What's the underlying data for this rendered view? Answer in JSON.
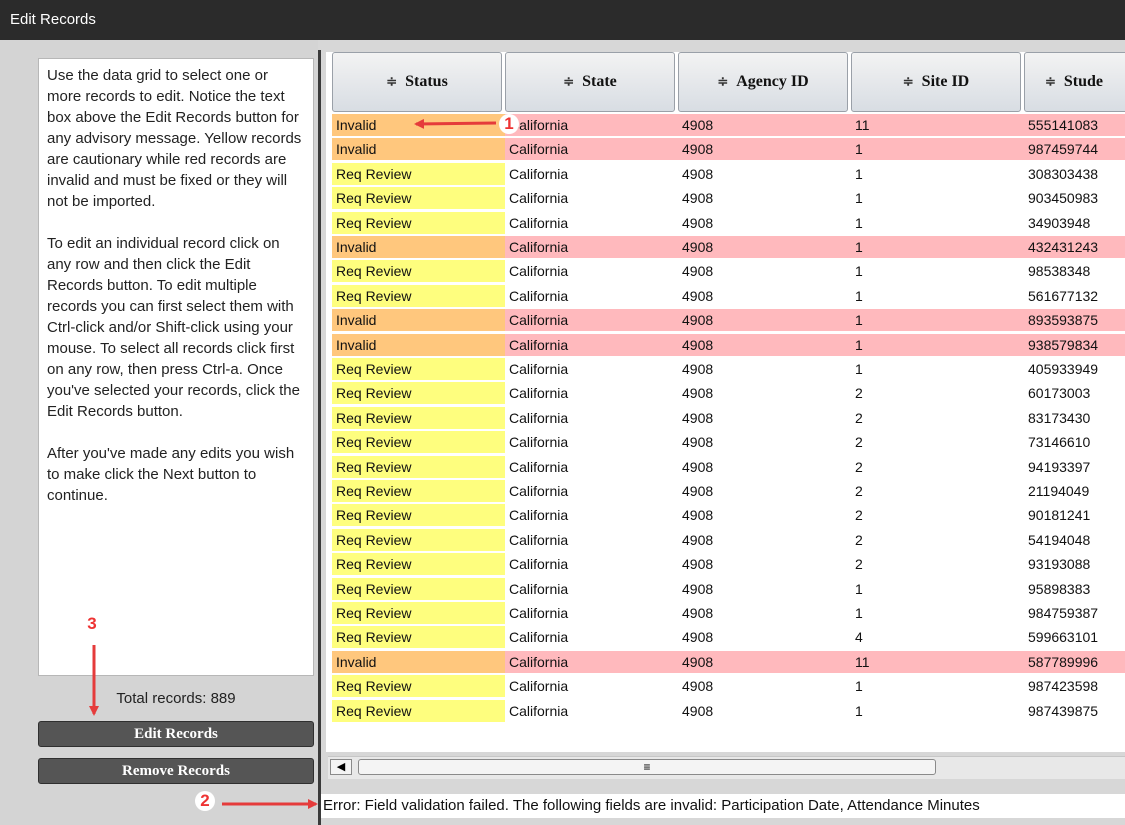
{
  "window": {
    "title": "Edit Records"
  },
  "help": {
    "paragraphs": [
      "Use the data grid to select one or more records to edit. Notice the text box above the Edit Records button for any advisory message. Yellow records are cautionary while red records are invalid and must be fixed or they will not be imported.",
      "To edit an individual record click on any row and then click the Edit Records button. To edit multiple records you can first select them with Ctrl-click and/or Shift-click using your mouse. To select all records click first on any row, then press Ctrl-a. Once you've selected your records, click the Edit Records button.",
      "After you've made any edits you wish to make click the Next button to continue."
    ]
  },
  "total_records": "Total records: 889",
  "buttons": {
    "edit": "Edit Records",
    "remove": "Remove Records"
  },
  "grid": {
    "sort_glyph": "≑",
    "columns": [
      "Status",
      "State",
      "Agency ID",
      "Site ID",
      "Stude"
    ],
    "rows": [
      [
        "Invalid",
        "California",
        "4908",
        "11",
        "555141083"
      ],
      [
        "Invalid",
        "California",
        "4908",
        "1",
        "987459744"
      ],
      [
        "Req Review",
        "California",
        "4908",
        "1",
        "308303438"
      ],
      [
        "Req Review",
        "California",
        "4908",
        "1",
        "903450983"
      ],
      [
        "Req Review",
        "California",
        "4908",
        "1",
        "34903948"
      ],
      [
        "Invalid",
        "California",
        "4908",
        "1",
        "432431243"
      ],
      [
        "Req Review",
        "California",
        "4908",
        "1",
        "98538348"
      ],
      [
        "Req Review",
        "California",
        "4908",
        "1",
        "561677132"
      ],
      [
        "Invalid",
        "California",
        "4908",
        "1",
        "893593875"
      ],
      [
        "Invalid",
        "California",
        "4908",
        "1",
        "938579834"
      ],
      [
        "Req Review",
        "California",
        "4908",
        "1",
        "405933949"
      ],
      [
        "Req Review",
        "California",
        "4908",
        "2",
        "60173003"
      ],
      [
        "Req Review",
        "California",
        "4908",
        "2",
        "83173430"
      ],
      [
        "Req Review",
        "California",
        "4908",
        "2",
        "73146610"
      ],
      [
        "Req Review",
        "California",
        "4908",
        "2",
        "94193397"
      ],
      [
        "Req Review",
        "California",
        "4908",
        "2",
        "21194049"
      ],
      [
        "Req Review",
        "California",
        "4908",
        "2",
        "90181241"
      ],
      [
        "Req Review",
        "California",
        "4908",
        "2",
        "54194048"
      ],
      [
        "Req Review",
        "California",
        "4908",
        "2",
        "93193088"
      ],
      [
        "Req Review",
        "California",
        "4908",
        "1",
        "95898383"
      ],
      [
        "Req Review",
        "California",
        "4908",
        "1",
        "984759387"
      ],
      [
        "Req Review",
        "California",
        "4908",
        "4",
        "599663101"
      ],
      [
        "Invalid",
        "California",
        "4908",
        "11",
        "587789996"
      ],
      [
        "Req Review",
        "California",
        "4908",
        "1",
        "987423598"
      ],
      [
        "Req Review",
        "California",
        "4908",
        "1",
        "987439875"
      ]
    ]
  },
  "scrollbar": {
    "left_arrow": "◀",
    "thumb_grip": "≡"
  },
  "status_message": "Error: Field validation failed. The following fields are invalid: Participation Date,  Attendance Minutes",
  "annotations": {
    "marker1": "1",
    "marker2": "2",
    "marker3": "3"
  },
  "colors": {
    "invalid_status_bg": "#ffc77d",
    "invalid_row_bg": "#ffb9bd",
    "review_status_bg": "#fefe7e",
    "review_row_bg": "#ffffff",
    "arrow": "#e53b3b"
  }
}
